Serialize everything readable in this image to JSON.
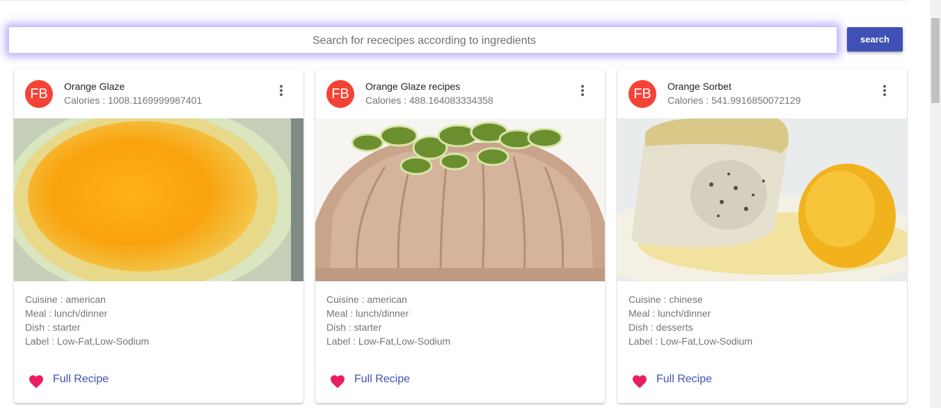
{
  "search": {
    "placeholder": "Search for rececipes according to ingredients",
    "button_label": "search"
  },
  "colors": {
    "accent": "#3f51b5",
    "avatar_bg": "#f44336",
    "heart": "#e91e63"
  },
  "cards": [
    {
      "avatar": "FB",
      "title": "Orange Glaze",
      "calories": "Calories : 1008.1169999987401",
      "cuisine": "Cuisine : american",
      "meal": "Meal : lunch/dinner",
      "dish": "Dish : starter",
      "label": "Label : Low-Fat,Low-Sodium",
      "link": "Full Recipe"
    },
    {
      "avatar": "FB",
      "title": "Orange Glaze recipes",
      "calories": "Calories : 488.164083334358",
      "cuisine": "Cuisine : american",
      "meal": "Meal : lunch/dinner",
      "dish": "Dish : starter",
      "label": "Label : Low-Fat,Low-Sodium",
      "link": "Full Recipe"
    },
    {
      "avatar": "FB",
      "title": "Orange Sorbet",
      "calories": "Calories : 541.9916850072129",
      "cuisine": "Cuisine : chinese",
      "meal": "Meal : lunch/dinner",
      "dish": "Dish : desserts",
      "label": "Label : Low-Fat,Low-Sodium",
      "link": "Full Recipe"
    }
  ]
}
